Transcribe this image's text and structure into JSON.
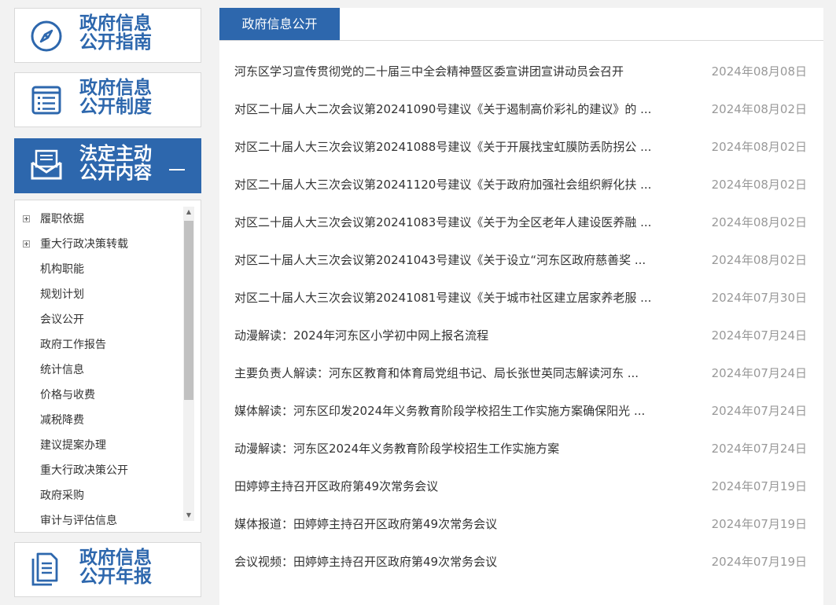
{
  "sidebar": {
    "guide": {
      "line1": "政府信息",
      "line2": "公开指南",
      "icon": "compass-icon"
    },
    "system": {
      "line1": "政府信息",
      "line2": "公开制度",
      "icon": "list-document-icon"
    },
    "statutory": {
      "line1": "法定主动",
      "line2": "公开内容",
      "icon": "mail-envelope-icon",
      "active": true
    },
    "annual": {
      "line1": "政府信息",
      "line2": "公开年报",
      "icon": "report-document-icon"
    },
    "tree_items": [
      {
        "label": "履职依据",
        "expandable": true
      },
      {
        "label": "重大行政决策转载",
        "expandable": true
      },
      {
        "label": "机构职能",
        "expandable": false
      },
      {
        "label": "规划计划",
        "expandable": false
      },
      {
        "label": "会议公开",
        "expandable": false
      },
      {
        "label": "政府工作报告",
        "expandable": false
      },
      {
        "label": "统计信息",
        "expandable": false
      },
      {
        "label": "价格与收费",
        "expandable": false
      },
      {
        "label": "减税降费",
        "expandable": false
      },
      {
        "label": "建议提案办理",
        "expandable": false
      },
      {
        "label": "重大行政决策公开",
        "expandable": false
      },
      {
        "label": "政府采购",
        "expandable": false
      },
      {
        "label": "审计与评估信息",
        "expandable": false
      }
    ]
  },
  "main": {
    "tab_label": "政府信息公开",
    "news": [
      {
        "title": "河东区学习宣传贯彻党的二十届三中全会精神暨区委宣讲团宣讲动员会召开",
        "date": "2024年08月08日"
      },
      {
        "title": "对区二十届人大二次会议第20241090号建议《关于遏制高价彩礼的建议》的 ...",
        "date": "2024年08月02日"
      },
      {
        "title": "对区二十届人大三次会议第20241088号建议《关于开展找宝虹膜防丢防拐公 ...",
        "date": "2024年08月02日"
      },
      {
        "title": "对区二十届人大三次会议第20241120号建议《关于政府加强社会组织孵化扶 ...",
        "date": "2024年08月02日"
      },
      {
        "title": "对区二十届人大三次会议第20241083号建议《关于为全区老年人建设医养融 ...",
        "date": "2024年08月02日"
      },
      {
        "title": "对区二十届人大三次会议第20241043号建议《关于设立“河东区政府慈善奖 ...",
        "date": "2024年08月02日"
      },
      {
        "title": "对区二十届人大三次会议第20241081号建议《关于城市社区建立居家养老服 ...",
        "date": "2024年07月30日"
      },
      {
        "title": "动漫解读：2024年河东区小学初中网上报名流程",
        "date": "2024年07月24日"
      },
      {
        "title": "主要负责人解读：河东区教育和体育局党组书记、局长张世英同志解读河东 ...",
        "date": "2024年07月24日"
      },
      {
        "title": "媒体解读：河东区印发2024年义务教育阶段学校招生工作实施方案确保阳光 ...",
        "date": "2024年07月24日"
      },
      {
        "title": "动漫解读：河东区2024年义务教育阶段学校招生工作实施方案",
        "date": "2024年07月24日"
      },
      {
        "title": "田婷婷主持召开区政府第49次常务会议",
        "date": "2024年07月19日"
      },
      {
        "title": "媒体报道：田婷婷主持召开区政府第49次常务会议",
        "date": "2024年07月19日"
      },
      {
        "title": "会议视频：田婷婷主持召开区政府第49次常务会议",
        "date": "2024年07月19日"
      }
    ]
  },
  "colors": {
    "accent": "#2d67ad",
    "date": "#999999",
    "text": "#333333",
    "background": "#f2f2f2"
  }
}
